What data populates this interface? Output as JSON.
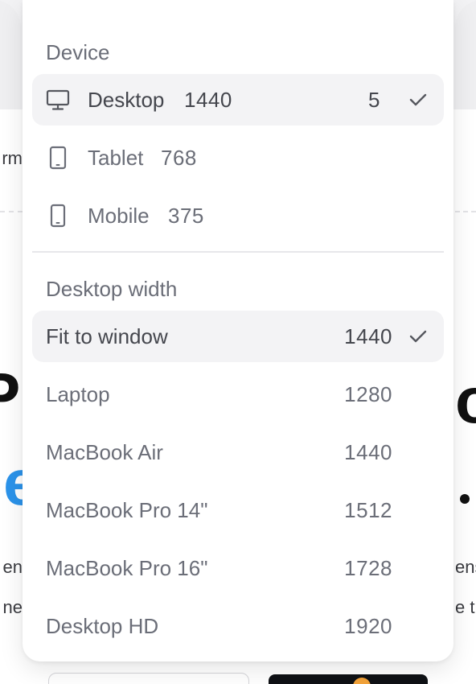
{
  "background": {
    "left_fragment_1": "rm",
    "left_fragment_2": "en",
    "left_fragment_3": "ne",
    "right_fragment_1": "ens",
    "right_fragment_2": "e tr",
    "big_left": "P",
    "big_right": "or",
    "blue_left": "e"
  },
  "menu": {
    "device_section_label": "Device",
    "devices": [
      {
        "label": "Desktop",
        "size": "1440",
        "count": "5",
        "icon": "monitor-icon",
        "selected": true
      },
      {
        "label": "Tablet",
        "size": "768",
        "icon": "tablet-icon",
        "selected": false
      },
      {
        "label": "Mobile",
        "size": "375",
        "icon": "mobile-icon",
        "selected": false
      }
    ],
    "width_section_label": "Desktop width",
    "widths": [
      {
        "label": "Fit to window",
        "value": "1440",
        "selected": true
      },
      {
        "label": "Laptop",
        "value": "1280",
        "selected": false
      },
      {
        "label": "MacBook Air",
        "value": "1440",
        "selected": false
      },
      {
        "label": "MacBook Pro 14\"",
        "value": "1512",
        "selected": false
      },
      {
        "label": "MacBook Pro 16\"",
        "value": "1728",
        "selected": false
      },
      {
        "label": "Desktop HD",
        "value": "1920",
        "selected": false
      }
    ]
  },
  "colors": {
    "menu_bg": "#ffffff",
    "selected_bg": "#f3f3f5",
    "text_muted": "#6b6e78",
    "accent_blue": "#2b93ea"
  }
}
